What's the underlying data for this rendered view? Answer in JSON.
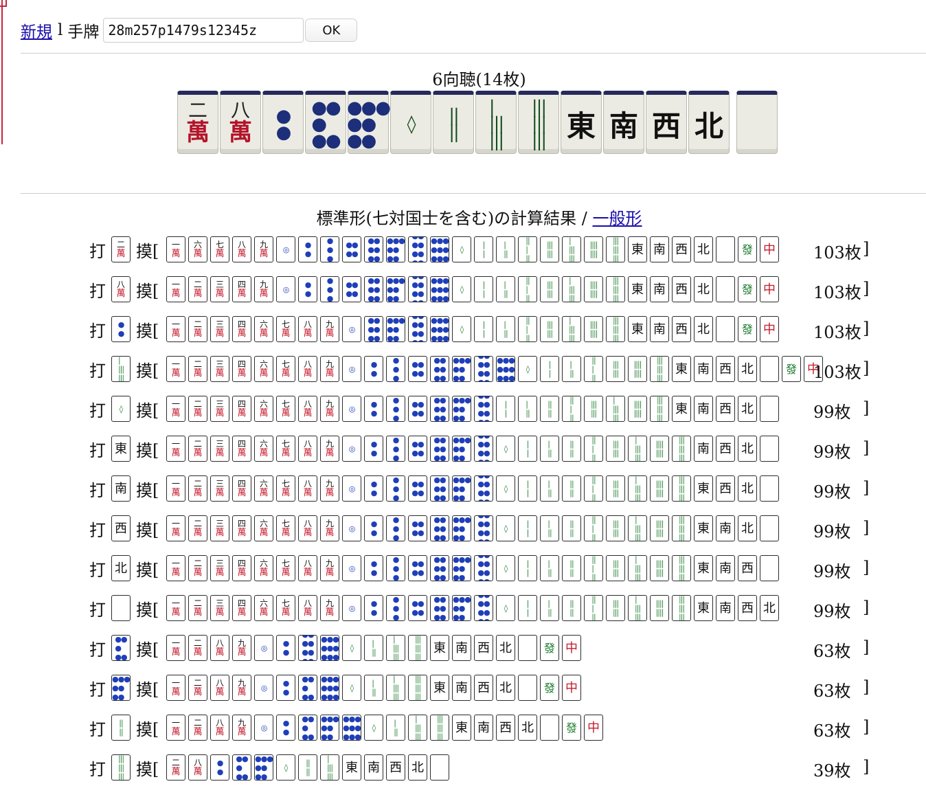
{
  "toolbar": {
    "new_link": "新規",
    "separator": "l",
    "hand_label": "手牌",
    "hand_value": "28m257p1479s12345z",
    "ok_label": "OK"
  },
  "shanten_text": "6向聴(14枚)",
  "big_hand": [
    {
      "suit": "man",
      "rank": "2",
      "kanji": "二"
    },
    {
      "suit": "man",
      "rank": "8",
      "kanji": "八"
    },
    {
      "suit": "pin",
      "rank": "2"
    },
    {
      "suit": "pin",
      "rank": "5"
    },
    {
      "suit": "pin",
      "rank": "7"
    },
    {
      "suit": "sou",
      "rank": "1"
    },
    {
      "suit": "sou",
      "rank": "4"
    },
    {
      "suit": "sou",
      "rank": "7"
    },
    {
      "suit": "sou",
      "rank": "9"
    },
    {
      "suit": "honor",
      "rank": "1",
      "kanji": "東"
    },
    {
      "suit": "honor",
      "rank": "2",
      "kanji": "南"
    },
    {
      "suit": "honor",
      "rank": "3",
      "kanji": "西"
    },
    {
      "suit": "honor",
      "rank": "4",
      "kanji": "北"
    },
    {
      "suit": "honor",
      "rank": "5",
      "kanji": ""
    }
  ],
  "result": {
    "title": "標準形(七対国士を含む)の計算結果 / ",
    "link": "一般形",
    "discard_label": "打",
    "draw_label": "摸[",
    "close_bracket": "]"
  },
  "rows": [
    {
      "discard": "2m",
      "draws": [
        "1m",
        "6m",
        "7m",
        "8m",
        "9m",
        "1p",
        "2p",
        "3p",
        "4p",
        "6p",
        "7p",
        "8p",
        "9p",
        "1s",
        "2s",
        "3s",
        "5s",
        "6s",
        "7s",
        "8s",
        "9s",
        "1z",
        "2z",
        "3z",
        "4z",
        "5z",
        "6z",
        "7z"
      ],
      "count": "103枚"
    },
    {
      "discard": "8m",
      "draws": [
        "1m",
        "2m",
        "3m",
        "4m",
        "9m",
        "1p",
        "2p",
        "3p",
        "4p",
        "6p",
        "7p",
        "8p",
        "9p",
        "1s",
        "2s",
        "3s",
        "5s",
        "6s",
        "7s",
        "8s",
        "9s",
        "1z",
        "2z",
        "3z",
        "4z",
        "5z",
        "6z",
        "7z"
      ],
      "count": "103枚"
    },
    {
      "discard": "2p",
      "draws": [
        "1m",
        "2m",
        "3m",
        "4m",
        "6m",
        "7m",
        "8m",
        "9m",
        "1p",
        "6p",
        "7p",
        "8p",
        "9p",
        "1s",
        "2s",
        "3s",
        "5s",
        "6s",
        "7s",
        "8s",
        "9s",
        "1z",
        "2z",
        "3z",
        "4z",
        "5z",
        "6z",
        "7z"
      ],
      "count": "103枚"
    },
    {
      "discard": "7s",
      "draws": [
        "1m",
        "2m",
        "3m",
        "4m",
        "6m",
        "7m",
        "8m",
        "9m",
        "1p",
        "2p",
        "3p",
        "4p",
        "6p",
        "7p",
        "8p",
        "9p",
        "1s",
        "2s",
        "3s",
        "5s",
        "6s",
        "8s",
        "9s",
        "1z",
        "2z",
        "3z",
        "4z",
        "5z",
        "6z",
        "7z"
      ],
      "count": "103枚"
    },
    {
      "discard": "1s",
      "draws": [
        "1m",
        "2m",
        "3m",
        "4m",
        "6m",
        "7m",
        "8m",
        "9m",
        "1p",
        "2p",
        "3p",
        "4p",
        "6p",
        "7p",
        "8p",
        "2s",
        "3s",
        "4s",
        "5s",
        "6s",
        "7s",
        "8s",
        "9s",
        "1z",
        "2z",
        "3z",
        "4z",
        "5z"
      ],
      "count": "99枚"
    },
    {
      "discard": "1z",
      "draws": [
        "1m",
        "2m",
        "3m",
        "4m",
        "6m",
        "7m",
        "8m",
        "9m",
        "1p",
        "2p",
        "3p",
        "4p",
        "6p",
        "7p",
        "8p",
        "1s",
        "2s",
        "3s",
        "4s",
        "5s",
        "6s",
        "7s",
        "8s",
        "9s",
        "2z",
        "3z",
        "4z",
        "5z"
      ],
      "count": "99枚"
    },
    {
      "discard": "2z",
      "draws": [
        "1m",
        "2m",
        "3m",
        "4m",
        "6m",
        "7m",
        "8m",
        "9m",
        "1p",
        "2p",
        "3p",
        "4p",
        "6p",
        "7p",
        "8p",
        "1s",
        "2s",
        "3s",
        "4s",
        "5s",
        "6s",
        "7s",
        "8s",
        "9s",
        "1z",
        "3z",
        "4z",
        "5z"
      ],
      "count": "99枚"
    },
    {
      "discard": "3z",
      "draws": [
        "1m",
        "2m",
        "3m",
        "4m",
        "6m",
        "7m",
        "8m",
        "9m",
        "1p",
        "2p",
        "3p",
        "4p",
        "6p",
        "7p",
        "8p",
        "1s",
        "2s",
        "3s",
        "4s",
        "5s",
        "6s",
        "7s",
        "8s",
        "9s",
        "1z",
        "2z",
        "4z",
        "5z"
      ],
      "count": "99枚"
    },
    {
      "discard": "4z",
      "draws": [
        "1m",
        "2m",
        "3m",
        "4m",
        "6m",
        "7m",
        "8m",
        "9m",
        "1p",
        "2p",
        "3p",
        "4p",
        "6p",
        "7p",
        "8p",
        "1s",
        "2s",
        "3s",
        "4s",
        "5s",
        "6s",
        "7s",
        "8s",
        "9s",
        "1z",
        "2z",
        "3z",
        "5z"
      ],
      "count": "99枚"
    },
    {
      "discard": "5z",
      "draws": [
        "1m",
        "2m",
        "3m",
        "4m",
        "6m",
        "7m",
        "8m",
        "9m",
        "1p",
        "2p",
        "3p",
        "4p",
        "6p",
        "7p",
        "8p",
        "1s",
        "2s",
        "3s",
        "4s",
        "5s",
        "6s",
        "7s",
        "8s",
        "9s",
        "1z",
        "2z",
        "3z",
        "4z"
      ],
      "count": "99枚"
    },
    {
      "discard": "5p",
      "draws": [
        "1m",
        "2m",
        "8m",
        "9m",
        "1p",
        "2p",
        "8p",
        "9p",
        "1s",
        "3s",
        "7s",
        "9s",
        "1z",
        "2z",
        "3z",
        "4z",
        "5z",
        "6z",
        "7z"
      ],
      "count": "63枚"
    },
    {
      "discard": "7p",
      "draws": [
        "1m",
        "2m",
        "8m",
        "9m",
        "1p",
        "2p",
        "5p",
        "9p",
        "1s",
        "3s",
        "7s",
        "9s",
        "1z",
        "2z",
        "3z",
        "4z",
        "5z",
        "6z",
        "7z"
      ],
      "count": "63枚"
    },
    {
      "discard": "4s",
      "draws": [
        "1m",
        "2m",
        "8m",
        "9m",
        "1p",
        "2p",
        "5p",
        "7p",
        "9p",
        "1s",
        "3s",
        "7s",
        "9s",
        "1z",
        "2z",
        "3z",
        "4z",
        "5z",
        "6z",
        "7z"
      ],
      "count": "63枚"
    },
    {
      "discard": "9s",
      "draws": [
        "2m",
        "8m",
        "2p",
        "5p",
        "7p",
        "1s",
        "4s",
        "7s",
        "1z",
        "2z",
        "3z",
        "4z",
        "5z"
      ],
      "count": "39枚"
    }
  ]
}
